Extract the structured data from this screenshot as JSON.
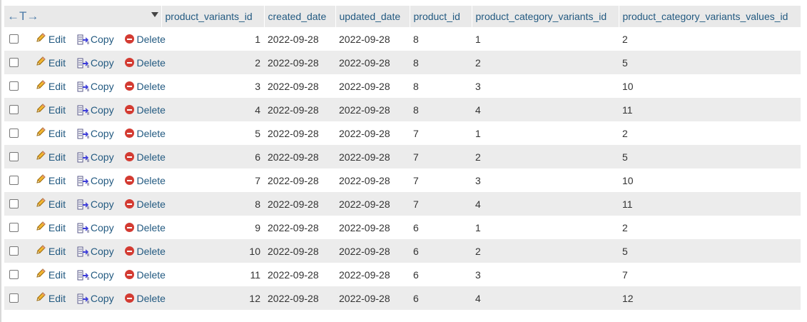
{
  "header": {
    "nav_label": "←T→",
    "columns": [
      "product_variants_id",
      "created_date",
      "updated_date",
      "product_id",
      "product_category_variants_id",
      "product_category_variants_values_id"
    ]
  },
  "actions": {
    "edit": "Edit",
    "copy": "Copy",
    "delete": "Delete"
  },
  "rows": [
    {
      "product_variants_id": "1",
      "created_date": "2022-09-28",
      "updated_date": "2022-09-28",
      "product_id": "8",
      "product_category_variants_id": "1",
      "product_category_variants_values_id": "2"
    },
    {
      "product_variants_id": "2",
      "created_date": "2022-09-28",
      "updated_date": "2022-09-28",
      "product_id": "8",
      "product_category_variants_id": "2",
      "product_category_variants_values_id": "5"
    },
    {
      "product_variants_id": "3",
      "created_date": "2022-09-28",
      "updated_date": "2022-09-28",
      "product_id": "8",
      "product_category_variants_id": "3",
      "product_category_variants_values_id": "10"
    },
    {
      "product_variants_id": "4",
      "created_date": "2022-09-28",
      "updated_date": "2022-09-28",
      "product_id": "8",
      "product_category_variants_id": "4",
      "product_category_variants_values_id": "11"
    },
    {
      "product_variants_id": "5",
      "created_date": "2022-09-28",
      "updated_date": "2022-09-28",
      "product_id": "7",
      "product_category_variants_id": "1",
      "product_category_variants_values_id": "2"
    },
    {
      "product_variants_id": "6",
      "created_date": "2022-09-28",
      "updated_date": "2022-09-28",
      "product_id": "7",
      "product_category_variants_id": "2",
      "product_category_variants_values_id": "5"
    },
    {
      "product_variants_id": "7",
      "created_date": "2022-09-28",
      "updated_date": "2022-09-28",
      "product_id": "7",
      "product_category_variants_id": "3",
      "product_category_variants_values_id": "10"
    },
    {
      "product_variants_id": "8",
      "created_date": "2022-09-28",
      "updated_date": "2022-09-28",
      "product_id": "7",
      "product_category_variants_id": "4",
      "product_category_variants_values_id": "11"
    },
    {
      "product_variants_id": "9",
      "created_date": "2022-09-28",
      "updated_date": "2022-09-28",
      "product_id": "6",
      "product_category_variants_id": "1",
      "product_category_variants_values_id": "2"
    },
    {
      "product_variants_id": "10",
      "created_date": "2022-09-28",
      "updated_date": "2022-09-28",
      "product_id": "6",
      "product_category_variants_id": "2",
      "product_category_variants_values_id": "5"
    },
    {
      "product_variants_id": "11",
      "created_date": "2022-09-28",
      "updated_date": "2022-09-28",
      "product_id": "6",
      "product_category_variants_id": "3",
      "product_category_variants_values_id": "7"
    },
    {
      "product_variants_id": "12",
      "created_date": "2022-09-28",
      "updated_date": "2022-09-28",
      "product_id": "6",
      "product_category_variants_id": "4",
      "product_category_variants_values_id": "12"
    }
  ],
  "icons": {
    "edit": "pencil-icon",
    "copy": "copy-icon",
    "delete": "delete-icon",
    "sort": "sort-down-icon"
  },
  "colors": {
    "link": "#235a81",
    "header_bg": "#e9e9e9",
    "row_alt_bg": "#ececec",
    "delete_red": "#d33b32"
  }
}
